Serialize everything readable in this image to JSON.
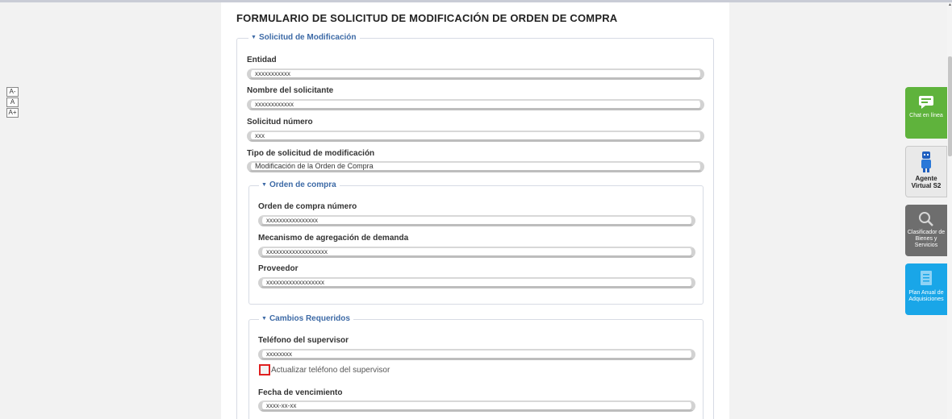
{
  "font_tools": [
    "A-",
    "A",
    "A+"
  ],
  "form": {
    "title": "FORMULARIO DE SOLICITUD DE MODIFICACIÓN DE ORDEN DE COMPRA",
    "solicitud": {
      "legend": "Solicitud de Modificación",
      "entidad_label": "Entidad",
      "entidad_value": "xxxxxxxxxxx",
      "nombre_label": "Nombre del solicitante",
      "nombre_value": "xxxxxxxxxxxx",
      "numero_label": "Solicitud número",
      "numero_value": "xxx",
      "tipo_label": "Tipo de solicitud de modificación",
      "tipo_value": "Modificación de la Orden de Compra"
    },
    "orden": {
      "legend": "Orden de compra",
      "numero_label": "Orden de compra número",
      "numero_value": "xxxxxxxxxxxxxxxx",
      "mecanismo_label": "Mecanismo de agregación de demanda",
      "mecanismo_value": "xxxxxxxxxxxxxxxxxxx",
      "proveedor_label": "Proveedor",
      "proveedor_value": "xxxxxxxxxxxxxxxxxx"
    },
    "cambios": {
      "legend": "Cambios Requeridos",
      "telefono_label": "Teléfono del supervisor",
      "telefono_value": "xxxxxxxx",
      "checkbox_label": "Actualizar teléfono del supervisor",
      "checkbox_checked": false,
      "fecha_label": "Fecha de vencimiento",
      "fecha_value": "xxxx-xx-xx"
    }
  },
  "side_buttons": {
    "chat": {
      "label": "Chat en línea",
      "icon": "chat-bubble-icon",
      "color": "#5fb33c"
    },
    "agente": {
      "label": "Agente Virtual S2",
      "icon": "robot-agent-icon",
      "color": "#e9e9e9"
    },
    "clasificador": {
      "label": "Clasificador de Bienes y Servicios",
      "icon": "magnifier-icon",
      "color": "#6e6e6e"
    },
    "plan": {
      "label": "Plan Anual de Adquisiciones",
      "icon": "document-icon",
      "color": "#19a6e8"
    }
  },
  "colors": {
    "legend": "#3d6aa6",
    "checkbox_highlight": "#e02020"
  }
}
